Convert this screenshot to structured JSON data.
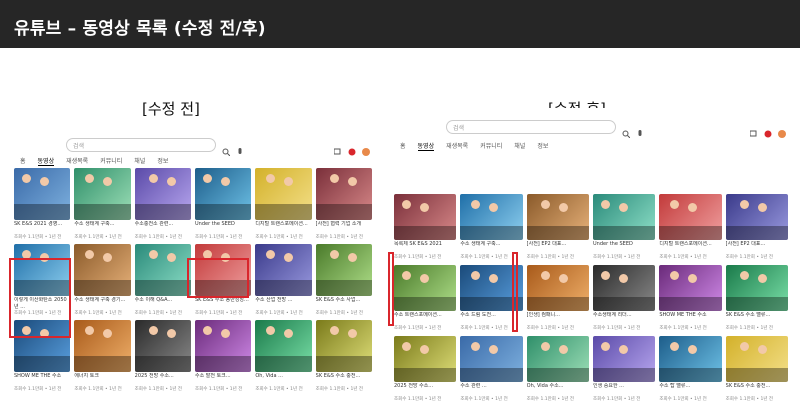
{
  "header": {
    "title": "유튜브 – 동영상 목록 (수정 전/후)"
  },
  "before": {
    "label": "[수정 전]",
    "search_placeholder": "검색",
    "tabs": [
      "홈",
      "동영상",
      "재생목록",
      "커뮤니티",
      "채널",
      "정보"
    ],
    "rows": [
      [
        "SK E&S 2021 경영...",
        "수소 생태계 구축...",
        "수소충전소 관련...",
        "Under the SEED",
        "디지털 트랜스포메이션...",
        "[사전] 협력 기업 소개"
      ],
      [
        "이렇게 이산화탄소 2050년 ...",
        "수소 생태계 구축 경기...",
        "수소 이해 Q&A...",
        "SK E&S 수소 동반성장...",
        "수소 산업 전망 ...",
        "SK E&S 수소 사업..."
      ],
      [
        "SHOW ME THE 수소",
        "에너지 토크",
        "2025 전망 수소...",
        "수소 발전 토크...",
        "Oh, Vida ...",
        "SK E&S 수소 충전..."
      ]
    ]
  },
  "after": {
    "label": "[수정 후]",
    "search_placeholder": "검색",
    "tabs": [
      "홈",
      "동영상",
      "재생목록",
      "커뮤니티",
      "채널",
      "정보"
    ],
    "rows": [
      [
        "목록체 SK E&S 2021",
        "수소 생태계 구축...",
        "[사전] EP2 대표...",
        "Under the SEED",
        "디지털 트랜스포메이션...",
        "[사전] EP2 대표..."
      ],
      [
        "수소 트랜스포메이션...",
        "수소 드림 도전...",
        "[인생] 컴패니...",
        "수소생태계 리더...",
        "SHOW ME THE 수소",
        "SK E&S 수소 밸류..."
      ],
      [
        "2025 전망 수소...",
        "수소 관련 ...",
        "Oh, Vida 수소...",
        "인생 중요한 ...",
        "수소 탑 밸류...",
        "SK E&S 수소 충전..."
      ]
    ]
  },
  "meta_line": "조회수 1.1만회 • 1년 전",
  "colors": {
    "highlight": "#d9262c",
    "header_bg": "#262626"
  }
}
